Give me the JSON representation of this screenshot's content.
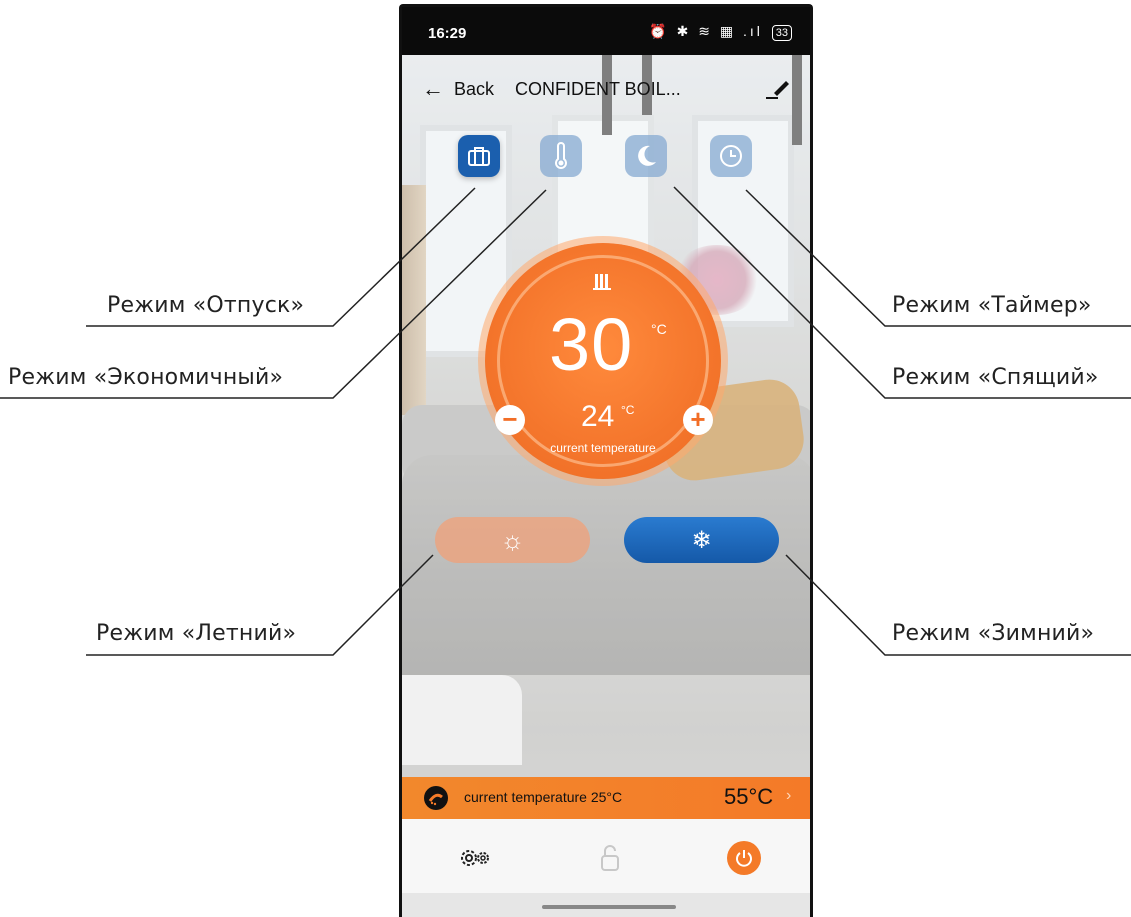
{
  "status_bar": {
    "time": "16:29",
    "icons": "⏰ ✱ ≋ ▦ .ıl",
    "battery": "33"
  },
  "header": {
    "back_label": "Back",
    "device_title": "CONFIDENT BOIL..."
  },
  "modes": [
    {
      "name": "vacation",
      "icon": "suitcase-icon",
      "active": true
    },
    {
      "name": "economy",
      "icon": "thermometer-icon",
      "active": false
    },
    {
      "name": "sleep",
      "icon": "moon-icon",
      "active": false
    },
    {
      "name": "timer",
      "icon": "clock-icon",
      "active": false
    }
  ],
  "dial": {
    "setpoint": "30",
    "setpoint_unit": "°C",
    "current": "24",
    "current_unit": "°C",
    "current_caption": "current temperature",
    "minus": "−",
    "plus": "+"
  },
  "season": {
    "summer_icon": "sun-icon",
    "winter_icon": "snowflake-icon",
    "winter_symbol": "❄",
    "summer_symbol": "☼"
  },
  "temp_bar": {
    "caption": "current temperature 25°C",
    "value": "55°C",
    "chevron": "›"
  },
  "callouts": {
    "vacation": "Режим «Отпуск»",
    "economy": "Режим «Экономичный»",
    "summer": "Режим «Летний»",
    "timer": "Режим «Таймер»",
    "sleep": "Режим «Спящий»",
    "winter": "Режим «Зимний»"
  },
  "colors": {
    "accent_orange": "#f47a28",
    "active_blue": "#1b5fae",
    "inactive_blue": "#85aad2"
  }
}
